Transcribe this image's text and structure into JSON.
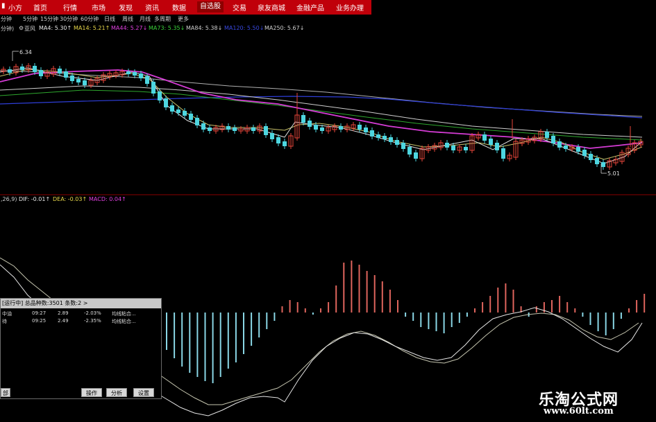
{
  "menu": {
    "logo": "小方",
    "items": [
      "首页",
      "行情",
      "市场",
      "发现",
      "资讯",
      "数据",
      "自选股",
      "交易",
      "泉友商城",
      "金融产品",
      "业务办理"
    ],
    "active": "自选股"
  },
  "periods": [
    "分钟",
    "5分钟",
    "15分钟",
    "30分钟",
    "60分钟",
    "日线",
    "周线",
    "月线",
    "多周期",
    "更多"
  ],
  "ma_bar": {
    "period": "分钟)",
    "stock": "亚风",
    "items": [
      {
        "label": "MA4: 5.30↑",
        "color": "#e8e8e8"
      },
      {
        "label": "MA14: 5.21↑",
        "color": "#e8d84a"
      },
      {
        "label": "MA44: 5.27↓",
        "color": "#e040e0"
      },
      {
        "label": "MA73: 5.35↓",
        "color": "#3ad23a"
      },
      {
        "label": "MA84: 5.38↓",
        "color": "#d0d0d0"
      },
      {
        "label": "MA120: 5.50↓",
        "color": "#3848e0"
      },
      {
        "label": "MA250: 5.67↓",
        "color": "#d0d0d0"
      }
    ]
  },
  "price_annotations": {
    "high": "6.34",
    "low": "5.01"
  },
  "macd_bar": [
    {
      "label": ",26,9)",
      "color": "#d0d0d0"
    },
    {
      "label": "DIF: -0.01↑",
      "color": "#e8e8e8"
    },
    {
      "label": "DEA: -0.03↑",
      "color": "#e8d84a"
    },
    {
      "label": "MACD: 0.04↑",
      "color": "#e040e0"
    }
  ],
  "panel": {
    "header": "[运行中] 总品种数:3501  条数:2  >",
    "rows": [
      {
        "name": "中油",
        "time": "09:27",
        "price": "2.89",
        "change": "-2.03%",
        "desc": "均线粘合..."
      },
      {
        "name": "待",
        "time": "09:25",
        "price": "2.49",
        "change": "-2.35%",
        "desc": "均线粘合..."
      }
    ],
    "buttons": {
      "left": "部",
      "operate": "操作",
      "analyze": "分析",
      "settings": "设置"
    }
  },
  "watermark": {
    "cn": "乐淘公式网",
    "url": "www.60lt.com"
  },
  "chart_data": {
    "type": "candlestick",
    "price_ylim": [
      4.9,
      6.45
    ],
    "annotations": {
      "high": 6.34,
      "low": 5.01
    },
    "macd_histogram": [
      -0.18,
      -0.22,
      -0.26,
      -0.29,
      -0.31,
      -0.33,
      -0.34,
      -0.31,
      -0.27,
      -0.24,
      -0.2,
      -0.16,
      -0.12,
      -0.08,
      -0.04,
      0.03,
      0.06,
      0.05,
      0.02,
      -0.01,
      0.02,
      0.05,
      0.13,
      0.24,
      0.25,
      0.23,
      0.2,
      0.18,
      0.15,
      0.11,
      0.06,
      -0.02,
      -0.04,
      -0.07,
      -0.08,
      -0.09,
      -0.1,
      -0.07,
      -0.05,
      -0.02,
      0.02,
      0.05,
      0.08,
      0.12,
      0.14,
      0.11,
      0.03,
      -0.02,
      0.03,
      0.05,
      0.06,
      0.08,
      0.05,
      0.02,
      -0.02,
      -0.06,
      -0.09,
      -0.11,
      -0.08,
      -0.03,
      0.02,
      0.06,
      0.09
    ]
  }
}
